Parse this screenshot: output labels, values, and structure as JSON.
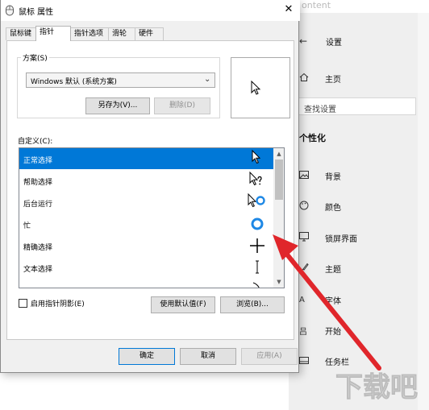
{
  "background": {
    "top_text": "ontent",
    "settings": {
      "title": "设置",
      "home": "主页",
      "search_placeholder": "查找设置",
      "section": "个性化",
      "items": [
        {
          "label": "背景",
          "icon": "picture-icon"
        },
        {
          "label": "颜色",
          "icon": "palette-icon"
        },
        {
          "label": "锁屏界面",
          "icon": "monitor-icon"
        },
        {
          "label": "主题",
          "icon": "brush-icon"
        },
        {
          "label": "字体",
          "icon": "font-icon"
        },
        {
          "label": "开始",
          "icon": "start-icon"
        },
        {
          "label": "任务栏",
          "icon": "taskbar-icon"
        }
      ],
      "font_icon_text": "A",
      "start_icon_text": "吕"
    }
  },
  "dialog": {
    "title": "鼠标 属性",
    "close_glyph": "✕",
    "tabs": [
      "鼠标键",
      "指针",
      "指针选项",
      "滑轮",
      "硬件"
    ],
    "active_tab": 1,
    "scheme_label": "方案(S)",
    "scheme_value": "Windows 默认 (系统方案)",
    "save_as_button": "另存为(V)...",
    "delete_button": "删除(D)",
    "customize_label": "自定义(C):",
    "cursor_list": [
      {
        "label": "正常选择",
        "cursor": "arrow",
        "selected": true
      },
      {
        "label": "帮助选择",
        "cursor": "help",
        "selected": false
      },
      {
        "label": "后台运行",
        "cursor": "working",
        "selected": false
      },
      {
        "label": "忙",
        "cursor": "busy",
        "selected": false
      },
      {
        "label": "精确选择",
        "cursor": "crosshair",
        "selected": false
      },
      {
        "label": "文本选择",
        "cursor": "ibeam",
        "selected": false
      }
    ],
    "enable_shadow_label": "启用指针阴影(E)",
    "enable_shadow_checked": false,
    "use_default_button": "使用默认值(F)",
    "browse_button": "浏览(B)...",
    "ok_button": "确定",
    "cancel_button": "取消",
    "apply_button": "应用(A)"
  },
  "watermark_text": "下载吧",
  "colors": {
    "selection": "#0078d7",
    "busy_ring": "#1e88e5",
    "arrow_annotation": "#e0262b"
  }
}
